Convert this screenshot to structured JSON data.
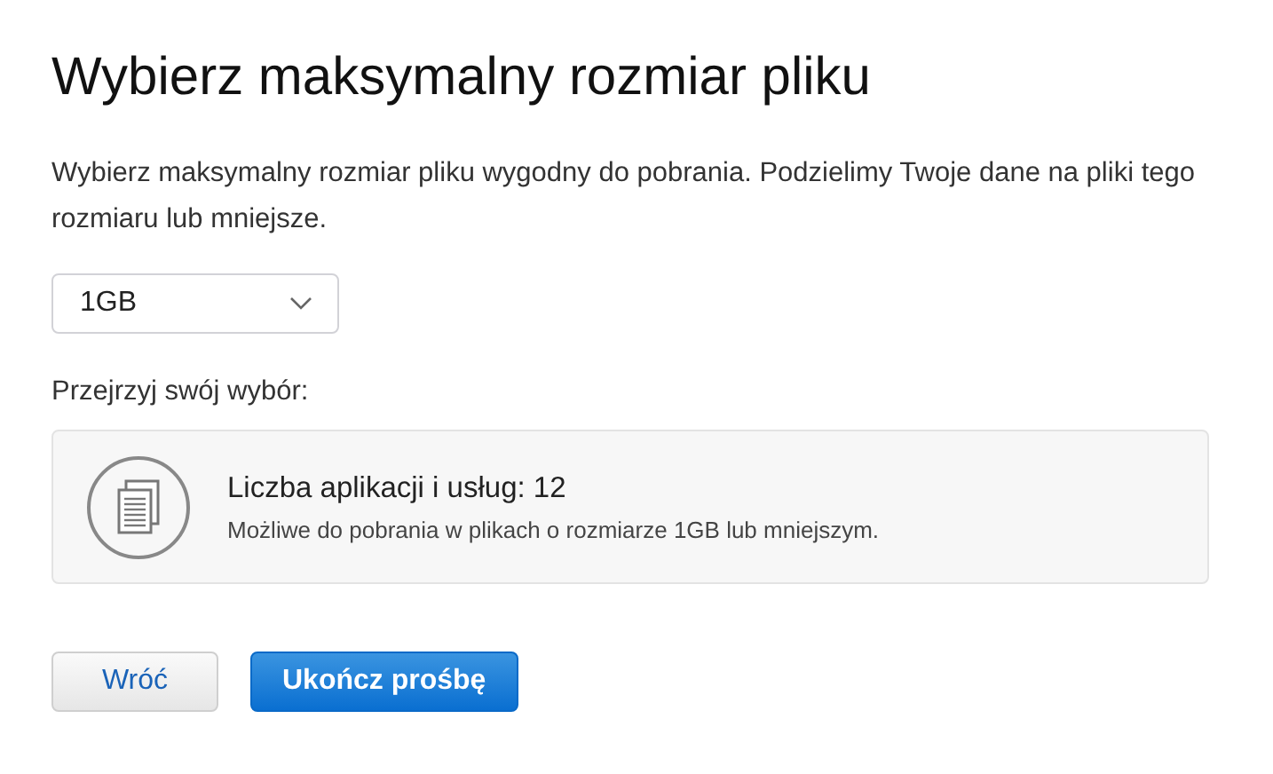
{
  "title": "Wybierz maksymalny rozmiar pliku",
  "description": "Wybierz maksymalny rozmiar pliku wygodny do pobrania. Podzielimy Twoje dane na pliki tego rozmiaru lub mniejsze.",
  "size_select": {
    "value": "1GB"
  },
  "review_label": "Przejrzyj swój wybór:",
  "summary": {
    "heading": "Liczba aplikacji i usług: 12",
    "detail": "Możliwe do pobrania w plikach o rozmiarze 1GB lub mniejszym."
  },
  "buttons": [
    {
      "label": "Wróć",
      "kind": "secondary"
    },
    {
      "label": "Ukończ prośbę",
      "kind": "primary"
    }
  ]
}
